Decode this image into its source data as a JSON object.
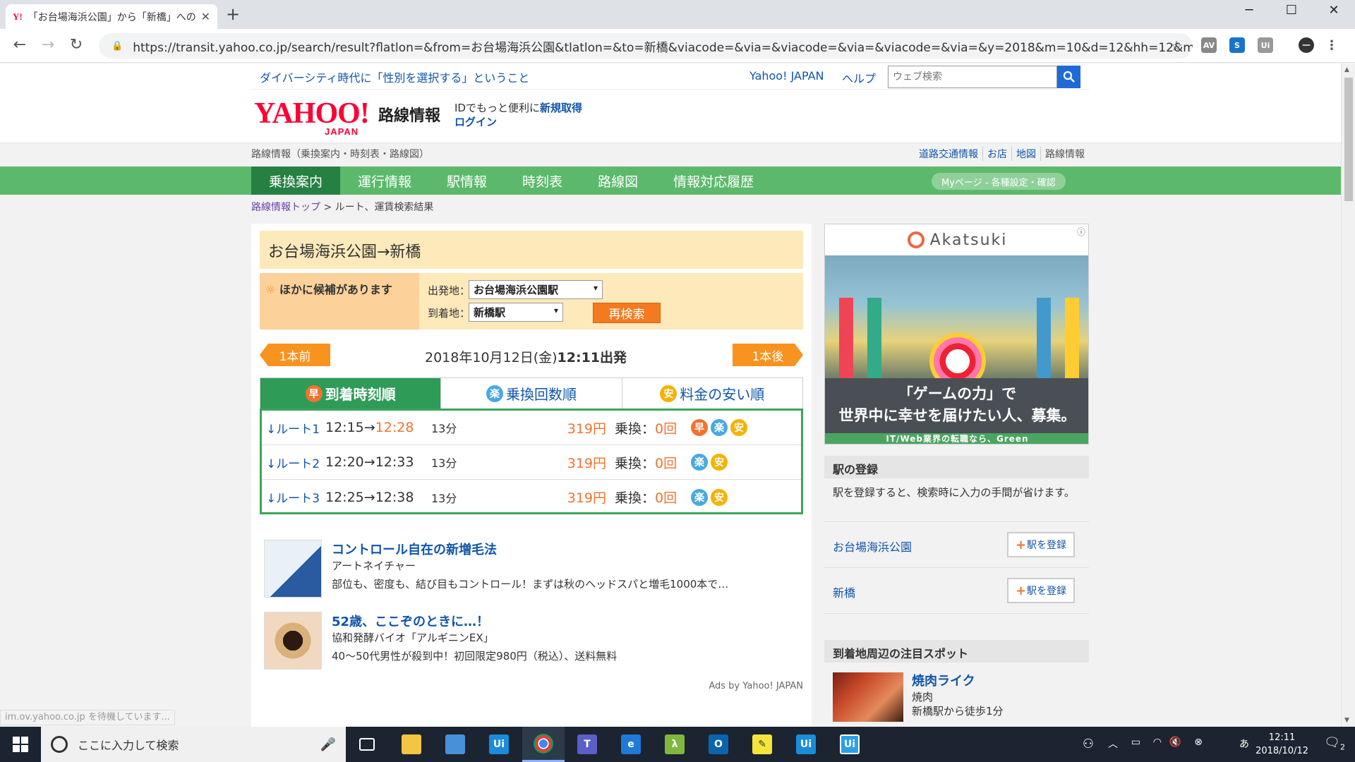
{
  "browser": {
    "tab_title": "「お台場海浜公園」から「新橋」への",
    "tab_favicon": "Y!",
    "url": "https://transit.yahoo.co.jp/search/result?flatlon=&from=お台場海浜公園&tlatlon=&to=新橋&viacode=&via=&viacode=&via=&viacode=&via=&y=2018&m=10&d=12&hh=12&m2=1&..."
  },
  "header": {
    "news_link": "ダイバーシティ時代に「性別を選択する」ということ",
    "yahoo_japan_link": "Yahoo! JAPAN",
    "help_link": "ヘルプ",
    "web_search_placeholder": "ウェブ検索",
    "logo_text": "YAHOO!",
    "logo_sub": "JAPAN",
    "site_name": "路線情報",
    "id_message_prefix": "IDでもっと便利に",
    "id_message_link": "新規取得",
    "login": "ログイン",
    "service_line": "路線情報（乗換案内・時刻表・路線図）",
    "service_links": [
      "道路交通情報",
      "お店",
      "地図",
      "路線情報"
    ]
  },
  "nav": {
    "tabs": [
      "乗換案内",
      "運行情報",
      "駅情報",
      "時刻表",
      "路線図",
      "情報対応履歴"
    ],
    "mypage": "Myページ - 各種設定・確認"
  },
  "breadcrumb": {
    "top": "路線情報トップ",
    "current": "> ルート、運賃検索結果"
  },
  "search": {
    "title": "お台場海浜公園→新橋",
    "candidates_notice": "ほかに候補があります",
    "from_label": "出発地：",
    "from_value": "お台場海浜公園駅",
    "to_label": "到着地：",
    "to_value": "新橋駅",
    "research_button": "再検索",
    "prev_button": "1本前",
    "next_button": "1本後",
    "date_text": "2018年10月12日(金)",
    "departure_time": "12:11出発"
  },
  "sort_tabs": [
    {
      "badge": "早",
      "label": "到着時刻順"
    },
    {
      "badge": "楽",
      "label": "乗換回数順"
    },
    {
      "badge": "安",
      "label": "料金の安い順"
    }
  ],
  "routes": [
    {
      "label": "↓ルート1",
      "depart": "12:15",
      "arrow": "→",
      "arrive": "12:28",
      "duration": "13分",
      "fare": "319円",
      "transfer_label": "乗換：",
      "transfers": "0回",
      "badges": [
        "早",
        "楽",
        "安"
      ]
    },
    {
      "label": "↓ルート2",
      "depart": "12:20",
      "arrow": "→",
      "arrive": "12:33",
      "duration": "13分",
      "fare": "319円",
      "transfer_label": "乗換：",
      "transfers": "0回",
      "badges": [
        "楽",
        "安"
      ]
    },
    {
      "label": "↓ルート3",
      "depart": "12:25",
      "arrow": "→",
      "arrive": "12:38",
      "duration": "13分",
      "fare": "319円",
      "transfer_label": "乗換：",
      "transfers": "0回",
      "badges": [
        "楽",
        "安"
      ]
    }
  ],
  "ads": [
    {
      "title": "コントロール自在の新増毛法",
      "sponsor": "アートネイチャー",
      "desc": "部位も、密度も、結び目もコントロール！まずは秋のヘッドスパと増毛1000本で…"
    },
    {
      "title": "52歳、ここぞのときに…！",
      "sponsor": "協和発酵バイオ「アルギニンEX」",
      "desc": "40～50代男性が殺到中！初回限定980円（税込）、送料無料"
    }
  ],
  "ads_by": "Ads by Yahoo! JAPAN",
  "sidebar": {
    "banner_brand": "Akatsuki",
    "banner_msg1": "「ゲームの力」で",
    "banner_msg2": "世界中に幸せを届けたい人、募集。",
    "banner_foot": "IT/Web業界の転職なら、Green",
    "station_reg_title": "駅の登録",
    "station_reg_desc": "駅を登録すると、検索時に入力の手間が省けます。",
    "stations": [
      {
        "name": "お台場海浜公園",
        "button": "駅を登録"
      },
      {
        "name": "新橋",
        "button": "駅を登録"
      }
    ],
    "spots_title": "到着地周辺の注目スポット",
    "spot": {
      "name": "焼肉ライク",
      "category": "焼肉",
      "walk": "新橋駅から徒歩1分"
    }
  },
  "status_bar": "im.ov.yahoo.co.jp を待機しています...",
  "taskbar": {
    "search_placeholder": "ここに入力して検索",
    "clock_time": "12:11",
    "clock_date": "2018/10/12",
    "notification_count": "2"
  },
  "colors": {
    "nav_green": "#5cb96b",
    "nav_active": "#268043",
    "orange": "#f07330",
    "link_blue": "#1155aa",
    "yahoo_red": "#ff0033"
  }
}
